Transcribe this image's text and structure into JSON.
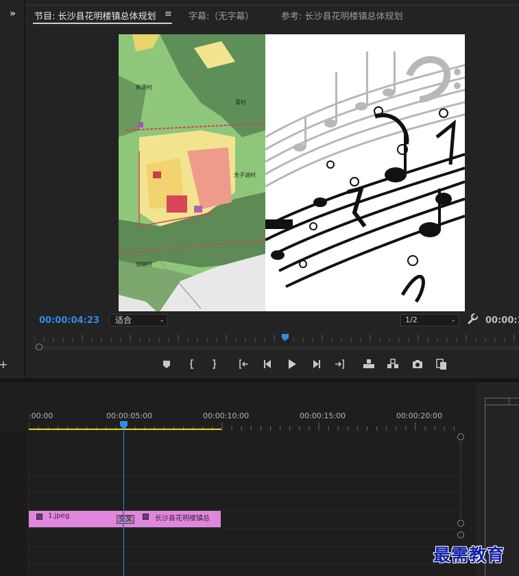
{
  "program_monitor": {
    "tabs": {
      "program": "节目: 长沙县花明楼镇总体规划",
      "program_menu_icon": "≡",
      "captions": "字幕:（无字幕）",
      "reference": "参考: 长沙县花明楼镇总体规划"
    },
    "collapse_chevron": "»",
    "current_timecode": "00:00:04:23",
    "fit_dropdown": {
      "selected": "适合",
      "arrow": "⌄"
    },
    "resolution_dropdown": {
      "selected": "1/2",
      "arrow": "⌄"
    },
    "duration_timecode": "00:00:1",
    "video": {
      "map_labels": [
        "新源村",
        "青村",
        "天子湖村",
        "双树村"
      ]
    },
    "transport_icons": [
      "add-marker-icon",
      "mark-in-icon",
      "mark-out-icon",
      "go-to-in-icon",
      "step-back-icon",
      "play-icon",
      "step-forward-icon",
      "go-to-out-icon",
      "lift-icon",
      "extract-icon",
      "export-frame-icon",
      "compare-view-icon"
    ]
  },
  "timeline": {
    "ruler_labels": [
      ":00:00",
      "00:00:05:00",
      "00:00:10:00",
      "00:00:15:00",
      "00:00:20:00"
    ],
    "clips": [
      {
        "name": "1.jpeg",
        "color": "#df87dc"
      },
      {
        "name": "长沙县花明楼镇总",
        "color": "#df87dc"
      }
    ],
    "transition_label": "交叉",
    "playhead_color": "#2d8ceb",
    "work_area_color": "#e5d72a"
  },
  "watermark": "最需教育",
  "colors": {
    "accent_blue": "#2d8ceb",
    "clip_pink": "#df87dc",
    "background": "#1d1d1d"
  }
}
